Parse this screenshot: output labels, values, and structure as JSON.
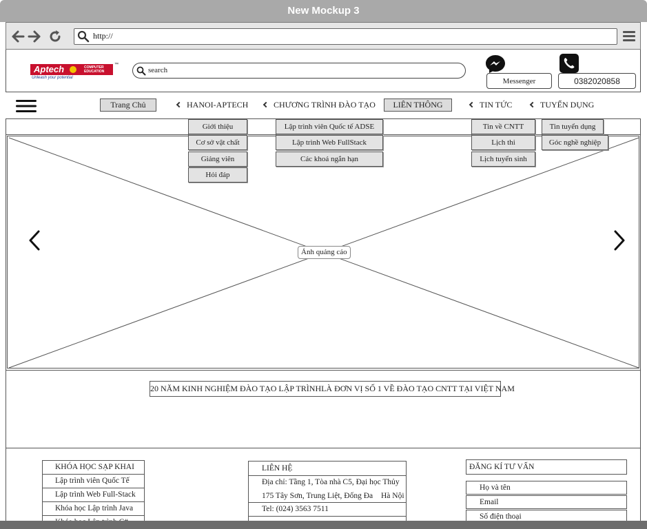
{
  "window": {
    "title": "New Mockup 3"
  },
  "browser": {
    "url": "http://"
  },
  "header": {
    "brand": "Aptech",
    "brand_sub": "COMPUTER EDUCATION",
    "brand_tagline": "Unleash your potential",
    "search_placeholder": "search",
    "messenger_label": "Messenger",
    "phone_label": "0382020858"
  },
  "nav": {
    "home": "Trang Chủ",
    "hanoi": "HANOI-APTECH",
    "program": "CHƯƠNG TRÌNH ĐÀO TẠO",
    "lien_thong": "LIÊN THÔNG",
    "news": "TIN TỨC",
    "jobs": "TUYỂN DỤNG"
  },
  "dropdowns": {
    "hanoi": [
      "Giới thiệu",
      "Cơ sở vật chất",
      "Giảng viên",
      "Hỏi đáp"
    ],
    "program": [
      "Lập trình viên Quốc tế ADSE",
      "Lập trình Web FullStack",
      "Các khoá ngắn hạn"
    ],
    "news": [
      "Tin về CNTT",
      "Lịch thi",
      "Lịch tuyển sinh"
    ],
    "jobs": [
      "Tin tuyển dụng",
      "Góc nghề nghiệp"
    ]
  },
  "banner": {
    "label": "Ảnh quảng cáo"
  },
  "tagline": "20 NĂM KINH NGHIỆM ĐÀO TẠO LẬP TRÌNHLÀ ĐƠN VỊ SỐ 1 VỀ ĐÀO TẠO CNTT TẠI VIỆT NAM",
  "footer": {
    "courses": {
      "title": "KHÓA HỌC SẠP KHAI",
      "items": [
        "Lập trình viên Quốc Tế",
        "Lập trình Web Full-Stack",
        "Khóa học Lập trình Java",
        "Khóa học Lập trình C#"
      ]
    },
    "contact": {
      "title": "LIÊN HỆ",
      "address_line1": "Địa chỉ: Tầng 1, Tòa nhà C5, Đại học Thủy",
      "address_line2": "175 Tây Sơn, Trung Liệt, Đống Đa",
      "address_city": "Hà Nội",
      "tel": "Tel: (024) 3563 7511"
    },
    "register": {
      "title": "ĐĂNG KÍ TƯ VẤN",
      "fields": [
        "Họ và tên",
        "Email",
        "Số điện thoại"
      ]
    }
  },
  "colors": {
    "chrome_bg": "#e6e6e6",
    "titlebar": "#a9a9a9",
    "brand_red": "#c8102e",
    "brand_text": "#1a3d8f"
  }
}
